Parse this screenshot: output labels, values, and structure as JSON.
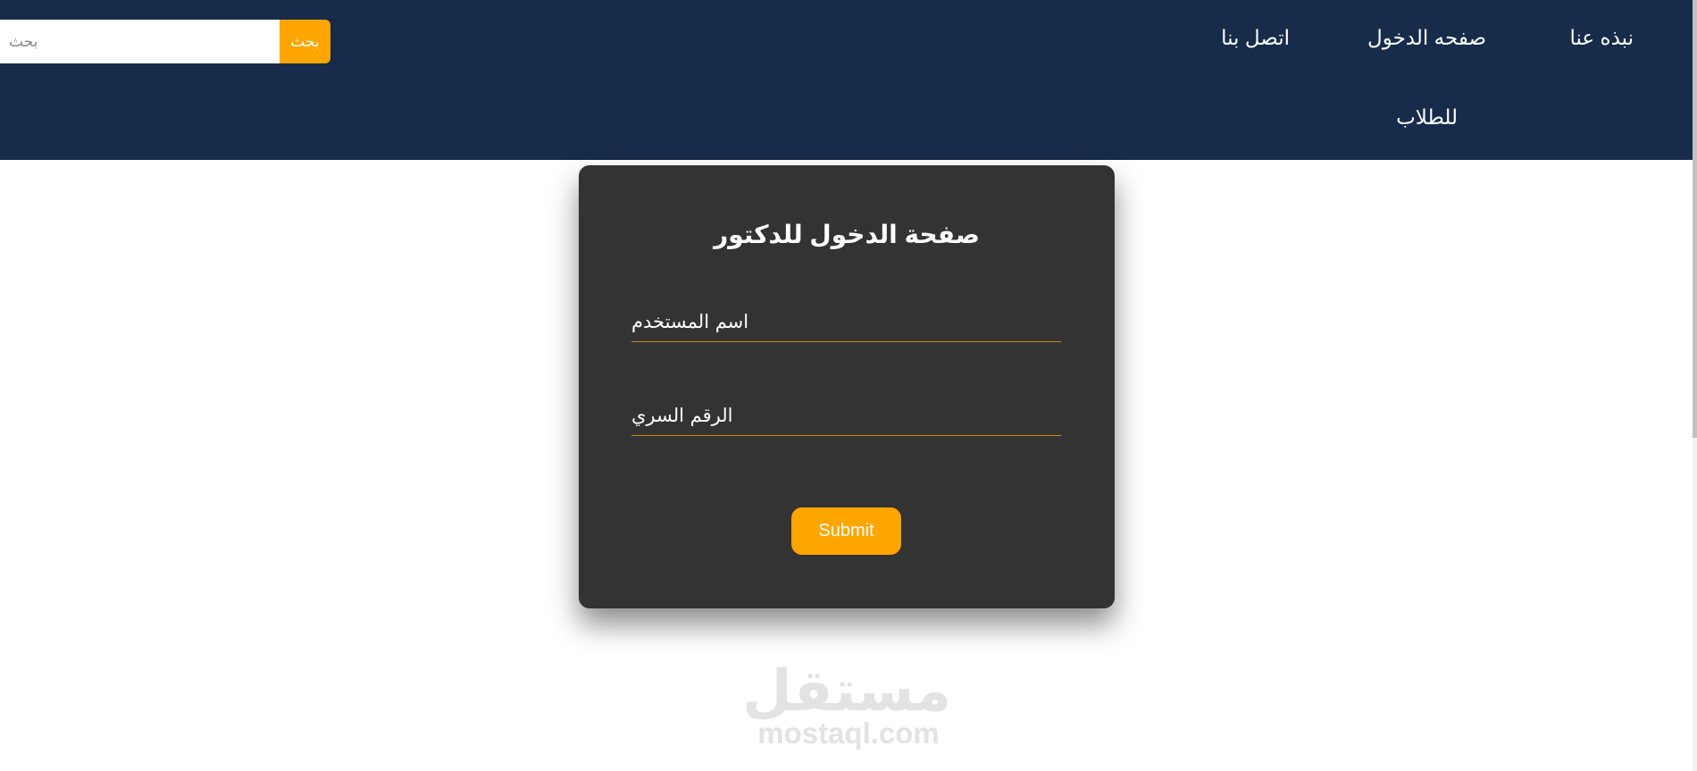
{
  "nav": {
    "about": "نبذه عنا",
    "login": "صفحه الدخول",
    "contact": "اتصل بنا",
    "students": "للطلاب"
  },
  "search": {
    "placeholder": "بحث",
    "button_label": "بحث"
  },
  "login_form": {
    "title": "صفحة الدخول للدكتور",
    "username_placeholder": "اسم المستخدم",
    "password_placeholder": "الرقم السري",
    "submit_label": "Submit"
  },
  "watermark": {
    "arabic": "مستقل",
    "latin": "mostaql.com"
  },
  "colors": {
    "navbar": "#172b4a",
    "accent": "#ffa500",
    "card": "#333333",
    "field_underline": "#c88a10"
  }
}
